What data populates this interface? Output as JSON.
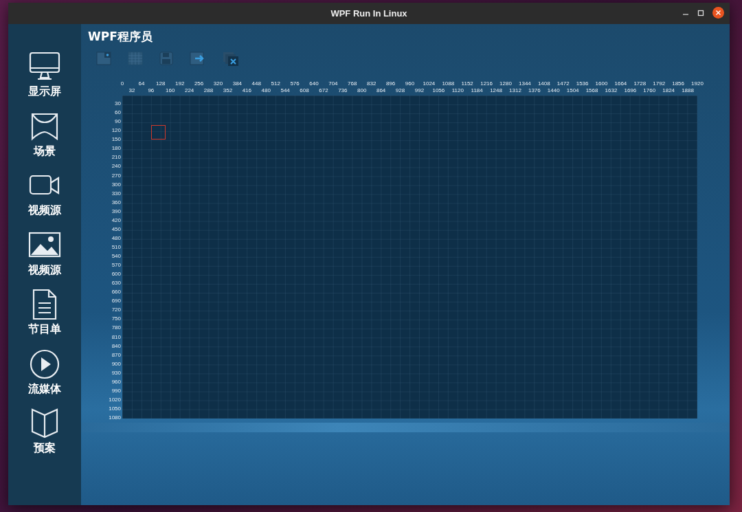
{
  "window": {
    "title": "WPF Run In Linux"
  },
  "app_title": "WPF程序员",
  "sidebar": {
    "items": [
      {
        "label": "显示屏",
        "kind": "monitor"
      },
      {
        "label": "场景",
        "kind": "scene"
      },
      {
        "label": "视频源",
        "kind": "camera"
      },
      {
        "label": "视频源",
        "kind": "image"
      },
      {
        "label": "节目单",
        "kind": "document"
      },
      {
        "label": "流媒体",
        "kind": "play"
      },
      {
        "label": "预案",
        "kind": "book"
      }
    ]
  },
  "canvas": {
    "x_ruler": [
      "0",
      "32",
      "64",
      "96",
      "128",
      "160",
      "192",
      "224",
      "256",
      "288",
      "320",
      "352",
      "384",
      "416",
      "448",
      "480",
      "512",
      "544",
      "576",
      "608",
      "640",
      "672",
      "704",
      "736",
      "768",
      "800",
      "832",
      "864",
      "896",
      "928",
      "960",
      "992",
      "1024",
      "1056",
      "1088",
      "1120",
      "1152",
      "1184",
      "1216",
      "1248",
      "1280",
      "1312",
      "1344",
      "1376",
      "1408",
      "1440",
      "1472",
      "1504",
      "1536",
      "1568",
      "1600",
      "1632",
      "1664",
      "1696",
      "1728",
      "1760",
      "1792",
      "1824",
      "1856",
      "1888",
      "1920"
    ],
    "y_ruler": [
      "30",
      "60",
      "90",
      "120",
      "150",
      "180",
      "210",
      "240",
      "270",
      "300",
      "330",
      "360",
      "390",
      "420",
      "450",
      "480",
      "510",
      "540",
      "570",
      "600",
      "630",
      "660",
      "690",
      "720",
      "750",
      "780",
      "810",
      "840",
      "870",
      "900",
      "930",
      "960",
      "990",
      "1020",
      "1050",
      "1080"
    ]
  }
}
